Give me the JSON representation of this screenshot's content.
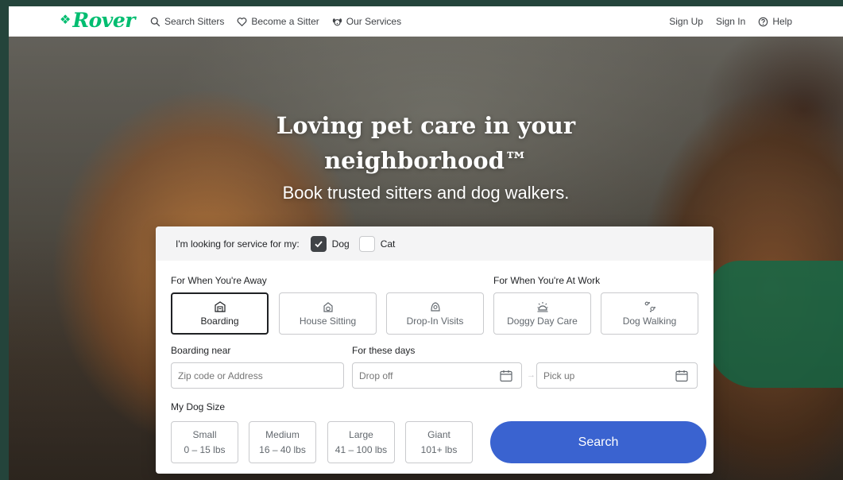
{
  "nav": {
    "logo": "Rover",
    "left_links": [
      {
        "label": "Search Sitters",
        "icon": "search-icon"
      },
      {
        "label": "Become a Sitter",
        "icon": "heart-icon"
      },
      {
        "label": "Our Services",
        "icon": "dog-face-icon"
      }
    ],
    "sign_up": "Sign Up",
    "sign_in": "Sign In",
    "help": "Help"
  },
  "hero": {
    "title_line1": "Loving pet care in your",
    "title_line2": "neighborhood™",
    "subtitle": "Book trusted sitters and dog walkers."
  },
  "search": {
    "looking_for_label": "I'm looking for service for my:",
    "pets": [
      {
        "label": "Dog",
        "checked": true
      },
      {
        "label": "Cat",
        "checked": false
      }
    ],
    "away_label": "For When You're Away",
    "work_label": "For When You're At Work",
    "services": [
      {
        "label": "Boarding",
        "icon": "boarding-house-icon",
        "selected": true
      },
      {
        "label": "House Sitting",
        "icon": "house-sitting-icon",
        "selected": false
      },
      {
        "label": "Drop-In Visits",
        "icon": "drop-in-icon",
        "selected": false
      },
      {
        "label": "Doggy Day Care",
        "icon": "sun-icon",
        "selected": false
      },
      {
        "label": "Dog Walking",
        "icon": "paw-prints-icon",
        "selected": false
      }
    ],
    "boarding_near_label": "Boarding near",
    "location_placeholder": "Zip code or Address",
    "dates_label": "For these days",
    "drop_off_placeholder": "Drop off",
    "pick_up_placeholder": "Pick up",
    "dog_size_label": "My Dog Size",
    "sizes": [
      {
        "label": "Small",
        "range": "0 – 15 lbs"
      },
      {
        "label": "Medium",
        "range": "16 – 40 lbs"
      },
      {
        "label": "Large",
        "range": "41 – 100 lbs"
      },
      {
        "label": "Giant",
        "range": "101+ lbs"
      }
    ],
    "search_button": "Search"
  },
  "colors": {
    "brand_green": "#00bd70",
    "search_blue": "#3a63d0",
    "frame_green": "#24443b"
  }
}
